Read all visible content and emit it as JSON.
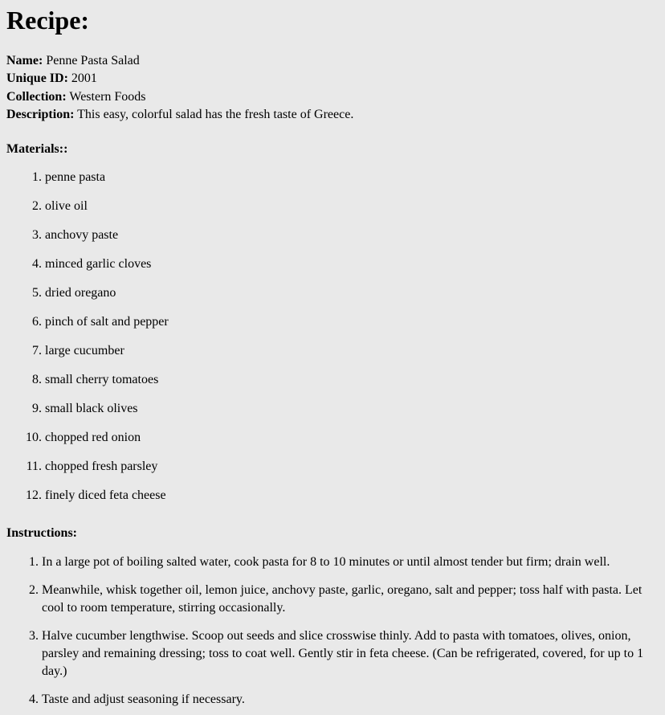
{
  "document": {
    "title": "Recipe:",
    "background_color": "#e9e9e9",
    "text_color": "#000000"
  },
  "metadata": {
    "name_label": "Name:",
    "name_value": "Penne Pasta Salad",
    "unique_id_label": "Unique ID:",
    "unique_id_value": "2001",
    "collection_label": "Collection:",
    "collection_value": "Western Foods",
    "description_label": "Description:",
    "description_value": "This easy, colorful salad has the fresh taste of Greece."
  },
  "materials": {
    "heading": "Materials::",
    "items": [
      "penne pasta",
      "olive oil",
      "anchovy paste",
      "minced garlic cloves",
      "dried oregano",
      "pinch of salt and pepper",
      "large cucumber",
      "small cherry tomatoes",
      "small black olives",
      "chopped red onion",
      "chopped fresh parsley",
      "finely diced feta cheese"
    ]
  },
  "instructions": {
    "heading": "Instructions:",
    "items": [
      "In a large pot of boiling salted water, cook pasta for 8 to 10 minutes or until almost tender but firm; drain well.",
      "Meanwhile, whisk together oil, lemon juice, anchovy paste, garlic, oregano, salt and pepper; toss half with pasta. Let cool to room temperature, stirring occasionally.",
      "Halve cucumber lengthwise. Scoop out seeds and slice crosswise thinly. Add to pasta with tomatoes, olives, onion, parsley and remaining dressing; toss to coat well. Gently stir in feta cheese. (Can be refrigerated, covered, for up to 1 day.)",
      "Taste and adjust seasoning if necessary."
    ]
  }
}
